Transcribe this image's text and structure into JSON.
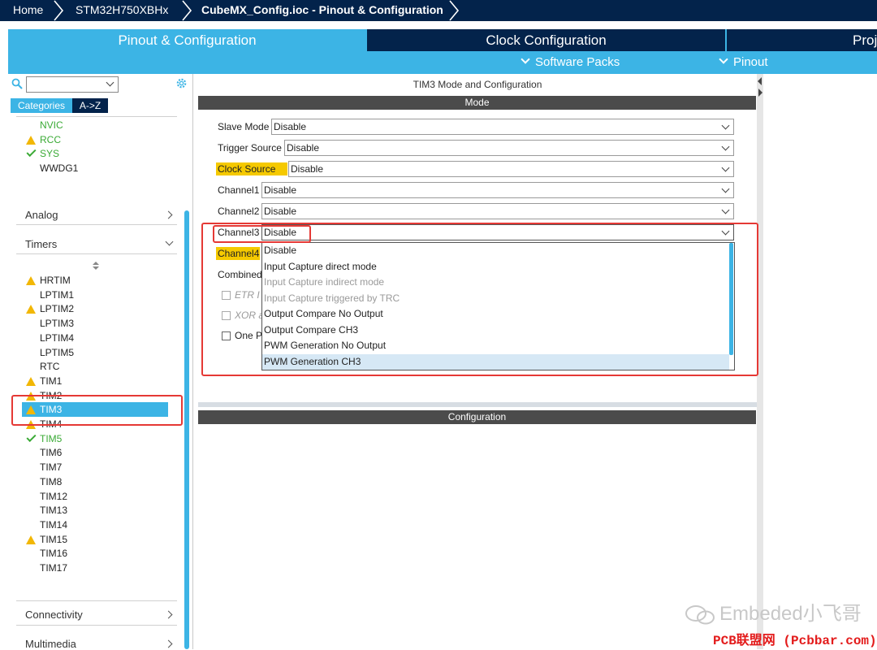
{
  "breadcrumb": {
    "items": [
      "Home",
      "STM32H750XBHx",
      "CubeMX_Config.ioc - Pinout & Configuration"
    ]
  },
  "tabs": {
    "pinout": "Pinout & Configuration",
    "clock": "Clock Configuration",
    "project": "Proj",
    "software_packs": "Software Packs",
    "pinout_menu": "Pinout"
  },
  "left": {
    "categories_btn": "Categories",
    "az_btn": "A->Z",
    "system_items": [
      {
        "label": "NVIC",
        "status": "none",
        "color": "green"
      },
      {
        "label": "RCC",
        "status": "warning",
        "color": "green"
      },
      {
        "label": "SYS",
        "status": "ok",
        "color": "green"
      },
      {
        "label": "WWDG1",
        "status": "none",
        "color": "default"
      }
    ],
    "sections": {
      "analog": "Analog",
      "timers": "Timers",
      "connectivity": "Connectivity",
      "multimedia": "Multimedia"
    },
    "timer_items": [
      {
        "label": "HRTIM",
        "status": "warning",
        "color": "default"
      },
      {
        "label": "LPTIM1",
        "status": "none",
        "color": "default"
      },
      {
        "label": "LPTIM2",
        "status": "warning",
        "color": "default"
      },
      {
        "label": "LPTIM3",
        "status": "none",
        "color": "default"
      },
      {
        "label": "LPTIM4",
        "status": "none",
        "color": "default"
      },
      {
        "label": "LPTIM5",
        "status": "none",
        "color": "default"
      },
      {
        "label": "RTC",
        "status": "none",
        "color": "default"
      },
      {
        "label": "TIM1",
        "status": "warning",
        "color": "default"
      },
      {
        "label": "TIM2",
        "status": "warning",
        "color": "default"
      },
      {
        "label": "TIM3",
        "status": "warning",
        "color": "selected"
      },
      {
        "label": "TIM4",
        "status": "warning",
        "color": "default"
      },
      {
        "label": "TIM5",
        "status": "ok",
        "color": "green"
      },
      {
        "label": "TIM6",
        "status": "none",
        "color": "default"
      },
      {
        "label": "TIM7",
        "status": "none",
        "color": "default"
      },
      {
        "label": "TIM8",
        "status": "none",
        "color": "default"
      },
      {
        "label": "TIM12",
        "status": "none",
        "color": "default"
      },
      {
        "label": "TIM13",
        "status": "none",
        "color": "default"
      },
      {
        "label": "TIM14",
        "status": "none",
        "color": "default"
      },
      {
        "label": "TIM15",
        "status": "warning",
        "color": "default"
      },
      {
        "label": "TIM16",
        "status": "none",
        "color": "default"
      },
      {
        "label": "TIM17",
        "status": "none",
        "color": "default"
      }
    ]
  },
  "center": {
    "title": "TIM3 Mode and Configuration",
    "mode_bar": "Mode",
    "config_bar": "Configuration",
    "fields": {
      "slave_mode": {
        "label": "Slave Mode",
        "value": "Disable"
      },
      "trigger_source": {
        "label": "Trigger Source",
        "value": "Disable"
      },
      "clock_source": {
        "label": "Clock Source",
        "value": "Disable"
      },
      "channel1": {
        "label": "Channel1",
        "value": "Disable"
      },
      "channel2": {
        "label": "Channel2",
        "value": "Disable"
      },
      "channel3": {
        "label": "Channel3",
        "value": "Disable"
      },
      "channel4": {
        "label": "Channel4"
      },
      "combined": {
        "label": "Combined"
      }
    },
    "checkboxes": {
      "etr": "ETR I",
      "xor": "XOR a",
      "one_pulse": "One P"
    },
    "dropdown_options": [
      {
        "label": "Disable",
        "state": "normal"
      },
      {
        "label": "Input Capture direct mode",
        "state": "normal"
      },
      {
        "label": "Input Capture indirect mode",
        "state": "disabled"
      },
      {
        "label": "Input Capture triggered by TRC",
        "state": "disabled"
      },
      {
        "label": "Output Compare No Output",
        "state": "normal"
      },
      {
        "label": "Output Compare CH3",
        "state": "normal"
      },
      {
        "label": "PWM Generation No Output",
        "state": "normal"
      },
      {
        "label": "PWM Generation CH3",
        "state": "hover"
      }
    ]
  },
  "watermark": {
    "line1": "Embeded小飞哥",
    "line2": "PCB联盟网 (Pcbbar.com)"
  },
  "colors": {
    "navy": "#03234b",
    "accent": "#3cb4e5",
    "warning": "#f2b705",
    "ok": "#3aaa35",
    "highlight": "#f5c900",
    "callout": "#e53935"
  }
}
